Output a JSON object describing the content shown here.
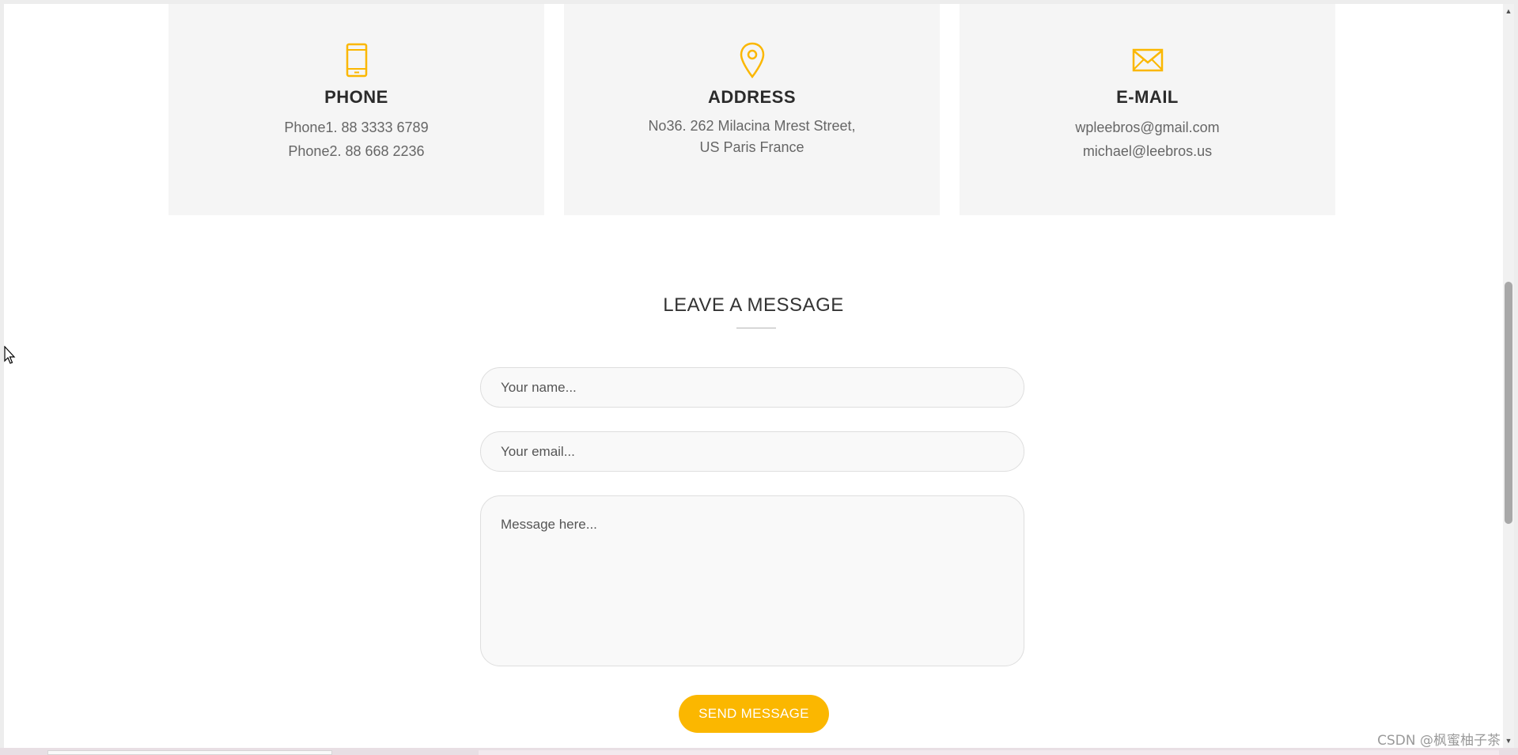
{
  "colors": {
    "accent": "#fbb700",
    "card_bg": "#f5f5f5",
    "page_bg": "#ffffff"
  },
  "contact_cards": [
    {
      "icon": "phone-icon",
      "title": "PHONE",
      "lines": [
        "Phone1. 88 3333 6789",
        "Phone2. 88 668 2236"
      ]
    },
    {
      "icon": "map-pin-icon",
      "title": "ADDRESS",
      "lines": [
        "No36. 262 Milacina Mrest Street,",
        "US Paris France"
      ]
    },
    {
      "icon": "envelope-icon",
      "title": "E-MAIL",
      "lines": [
        "wpleebros@gmail.com",
        "michael@leebros.us"
      ]
    }
  ],
  "form": {
    "heading": "LEAVE A MESSAGE",
    "name_placeholder": "Your name...",
    "email_placeholder": "Your email...",
    "message_placeholder": "Message here...",
    "submit_label": "SEND MESSAGE"
  },
  "watermark": "CSDN @枫蜜柚子茶"
}
